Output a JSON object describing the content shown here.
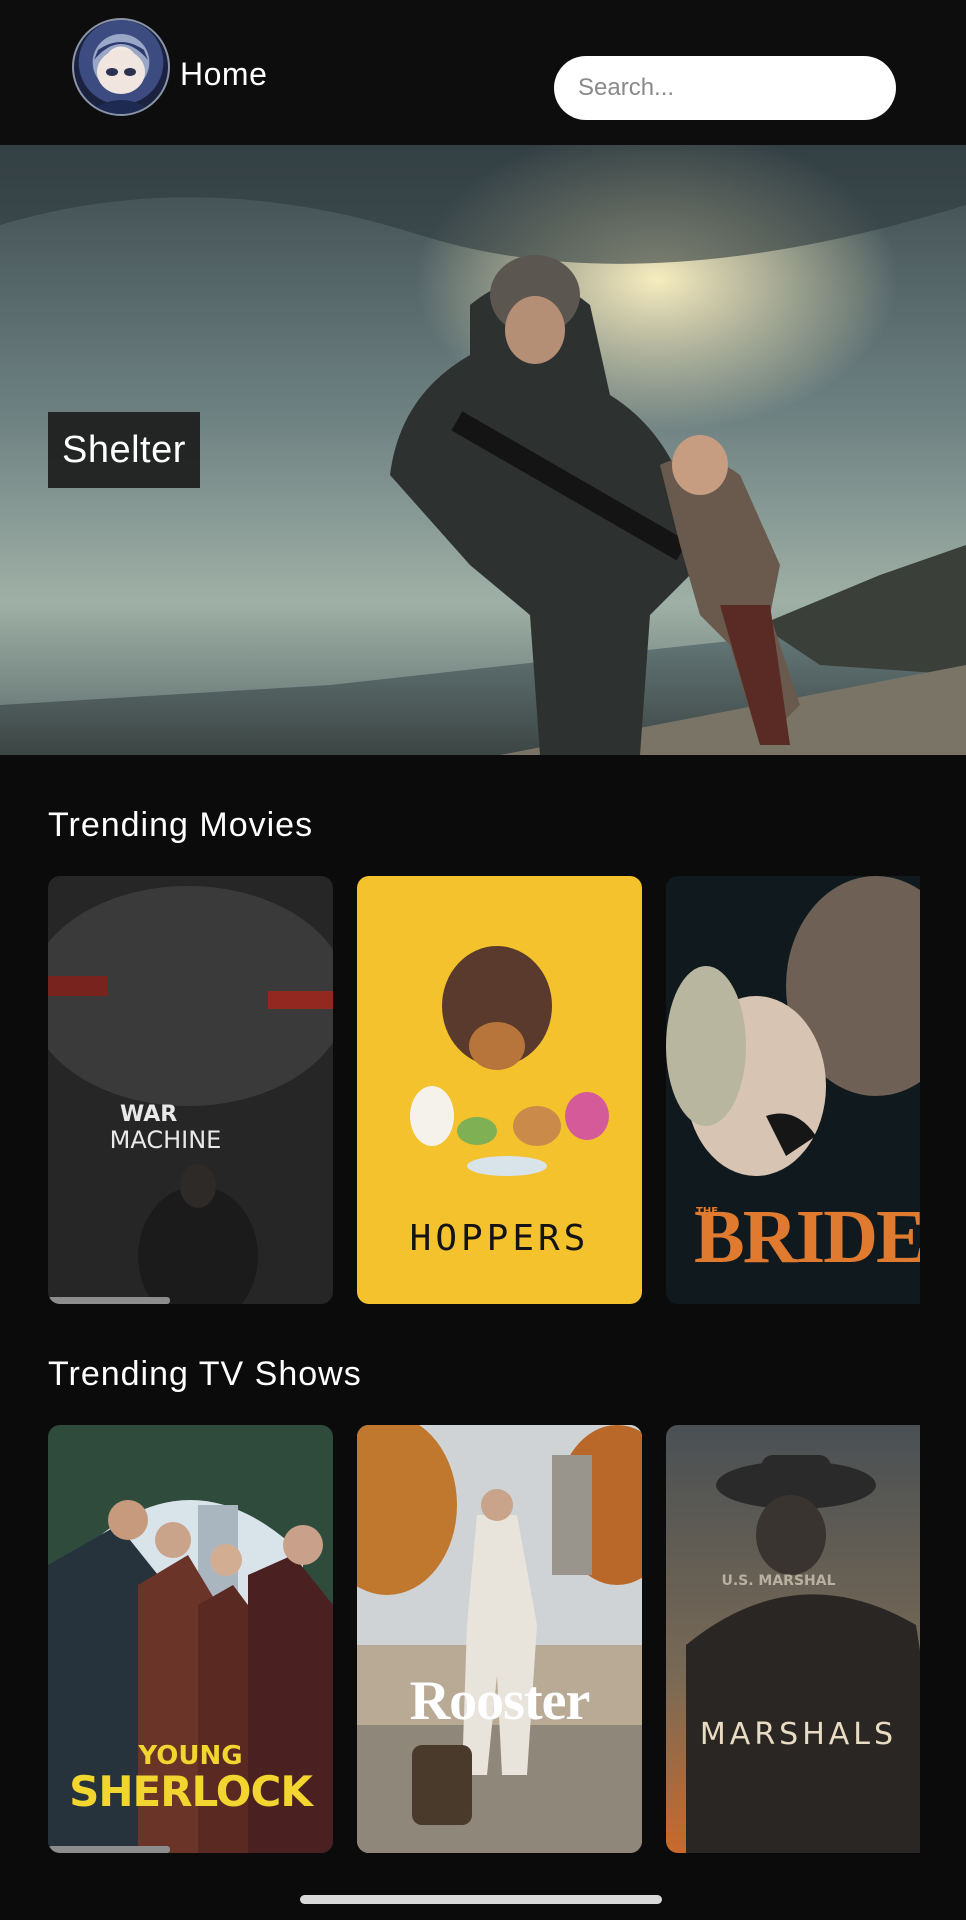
{
  "header": {
    "title": "Home",
    "search_placeholder": "Search..."
  },
  "hero": {
    "title": "Shelter"
  },
  "sections": {
    "movies": {
      "title": "Trending Movies",
      "posters": [
        {
          "title": "WAR MACHINE",
          "line1": "WAR",
          "line2": "MACHINE"
        },
        {
          "title": "HOPPERS"
        },
        {
          "title": "BRIDE!",
          "small": "THE"
        }
      ]
    },
    "tv": {
      "title": "Trending TV Shows",
      "posters": [
        {
          "title": "YOUNG SHERLOCK",
          "line1": "YOUNG",
          "line2": "SHERLOCK"
        },
        {
          "title": "Rooster"
        },
        {
          "title": "MARSHALS",
          "small": "U.S. MARSHAL"
        }
      ]
    }
  },
  "colors": {
    "background": "#0b0b0c",
    "search_bg": "#ffffff",
    "hoppers_bg": "#f3c22c",
    "bride_text": "#e07a2e",
    "sherlock_text": "#f2d52f"
  }
}
